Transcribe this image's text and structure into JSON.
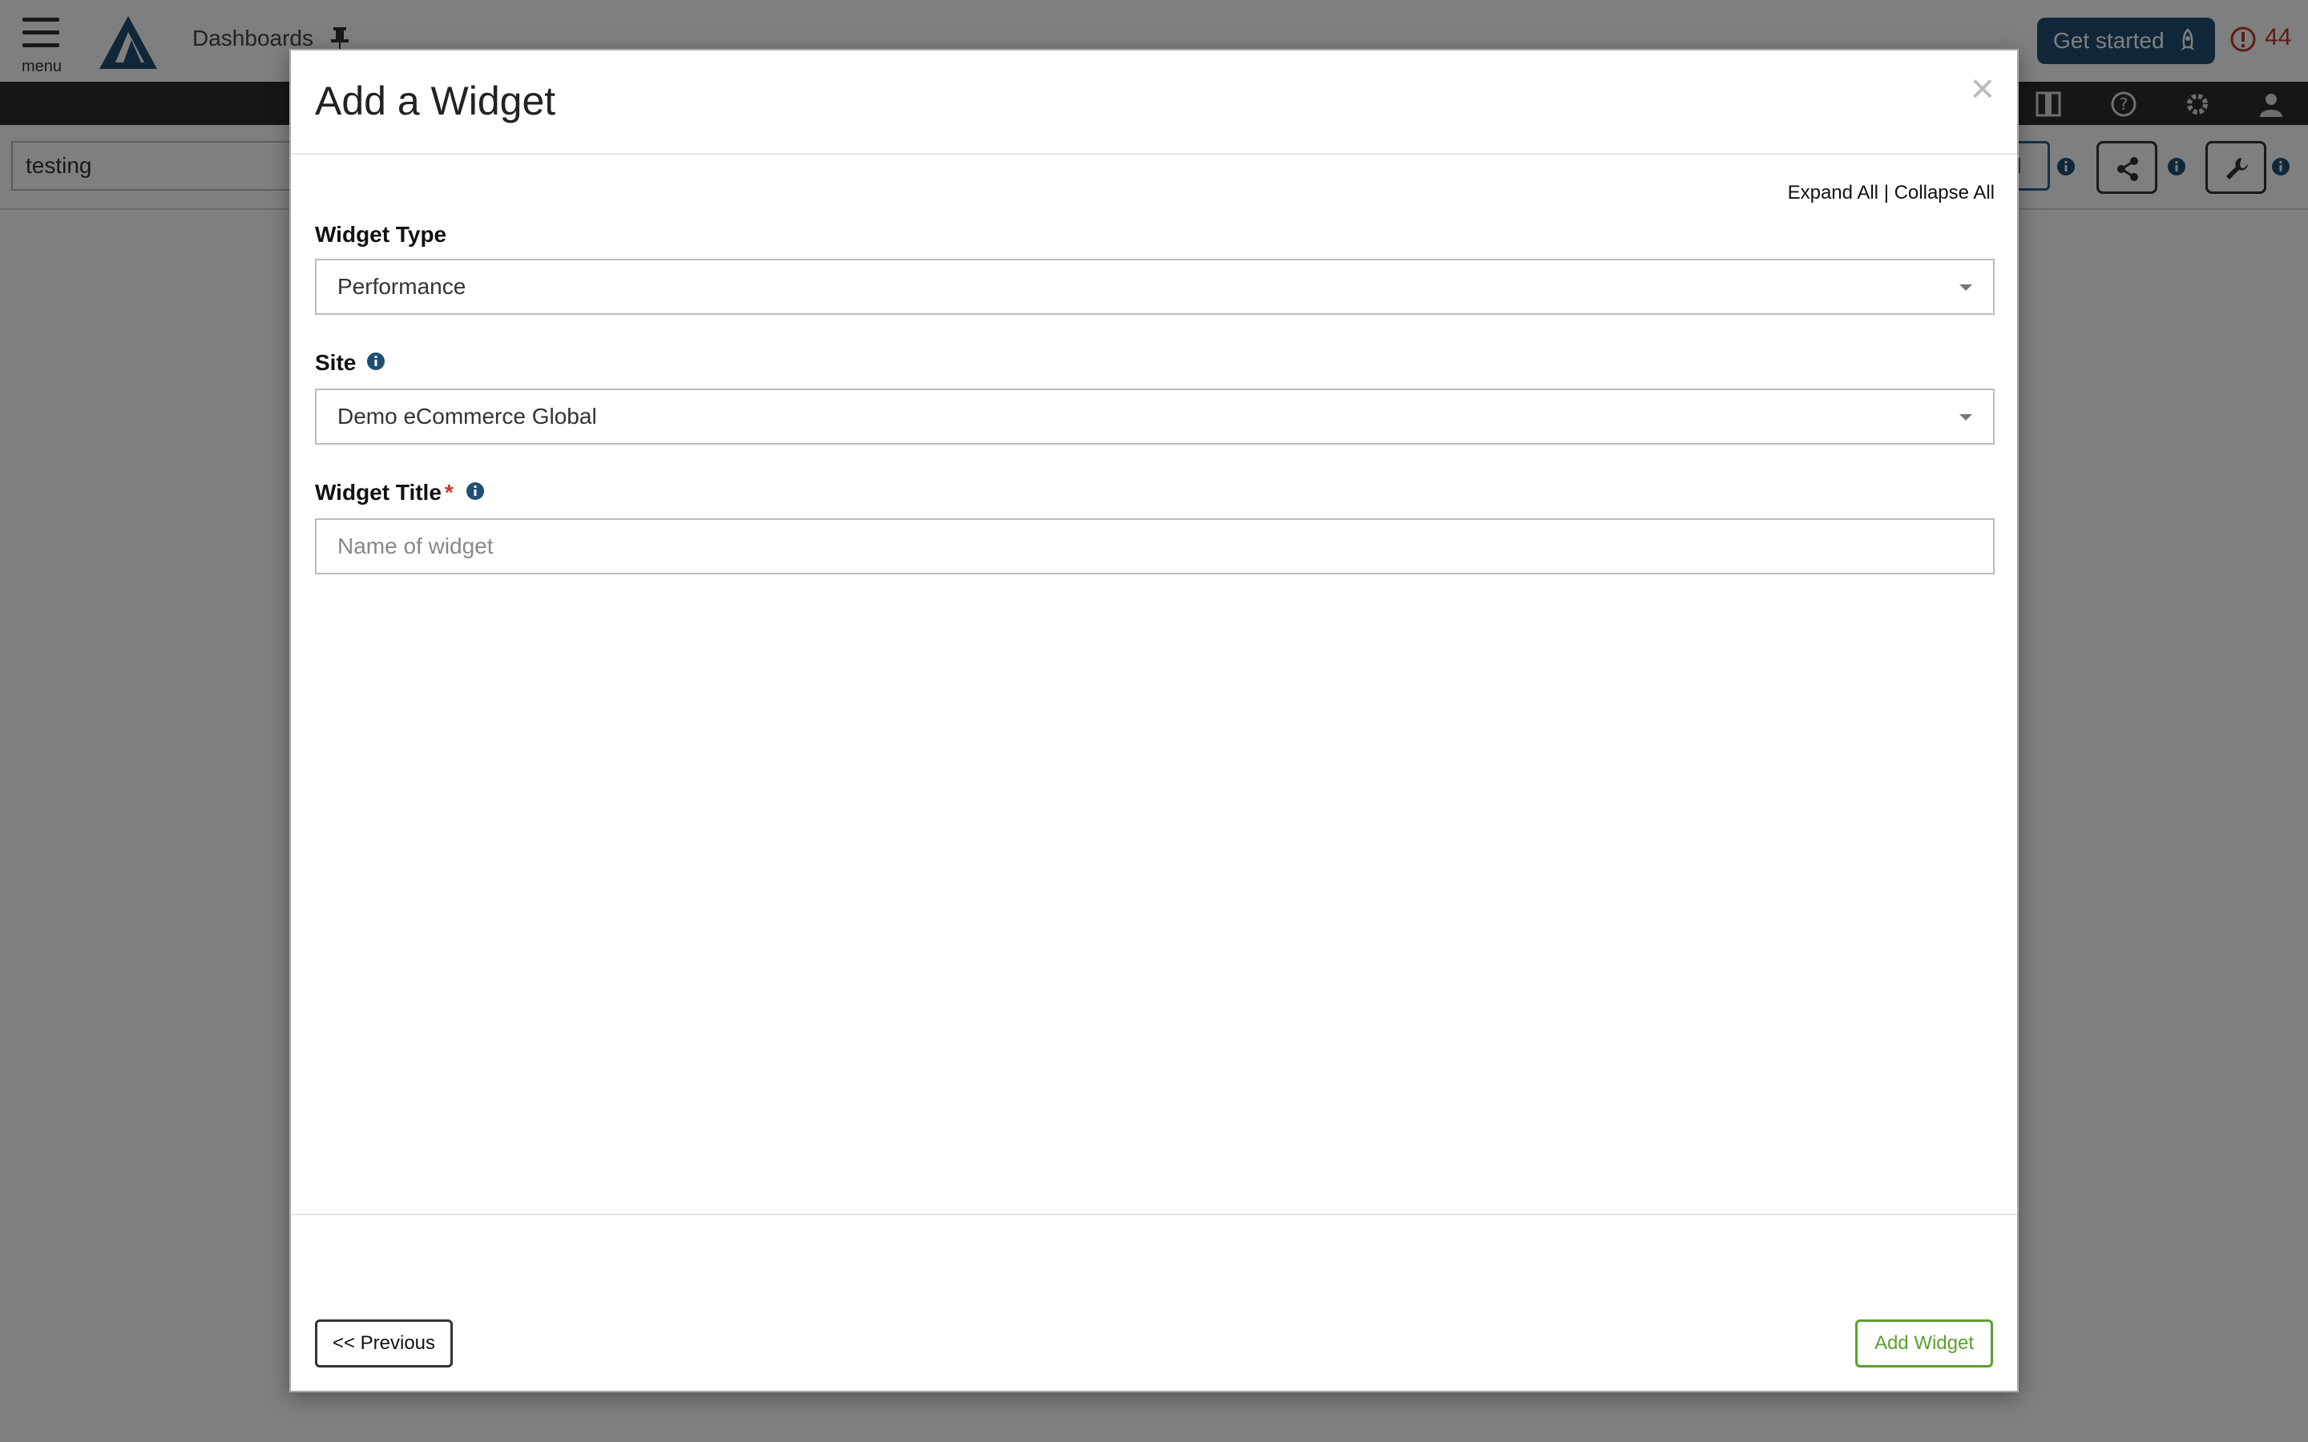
{
  "app": {
    "menu_label": "menu",
    "nav_title": "Dashboards",
    "get_started_label": "Get started",
    "alert_count": "44",
    "dashboard_name": "testing",
    "partial_button_text": "d",
    "icons": {
      "logo": "app-logo",
      "pin": "pin-icon",
      "rocket": "rocket-icon",
      "alert": "alert-circle-icon",
      "film": "film-icon",
      "help": "help-icon",
      "gear": "gear-icon",
      "user": "user-icon",
      "share": "share-icon",
      "wrench": "wrench-icon",
      "info": "info-icon"
    },
    "colors": {
      "brand_dark": "#1f4f73",
      "alert_red": "#c0392b",
      "dark_bar": "#2d2d2d"
    }
  },
  "modal": {
    "title": "Add a Widget",
    "close_symbol": "×",
    "expand_all": "Expand All",
    "separator": "|",
    "collapse_all": "Collapse All",
    "widget_type": {
      "label": "Widget Type",
      "value": "Performance"
    },
    "site": {
      "label": "Site",
      "value": "Demo eCommerce Global"
    },
    "widget_title": {
      "label": "Widget Title",
      "required_marker": "*",
      "value": "",
      "placeholder": "Name of widget"
    },
    "previous_button": "<< Previous",
    "add_button": "Add Widget",
    "colors": {
      "add_button_green": "#5aa02c",
      "info_blue": "#1f4f73",
      "required_red": "#c0392b"
    }
  }
}
